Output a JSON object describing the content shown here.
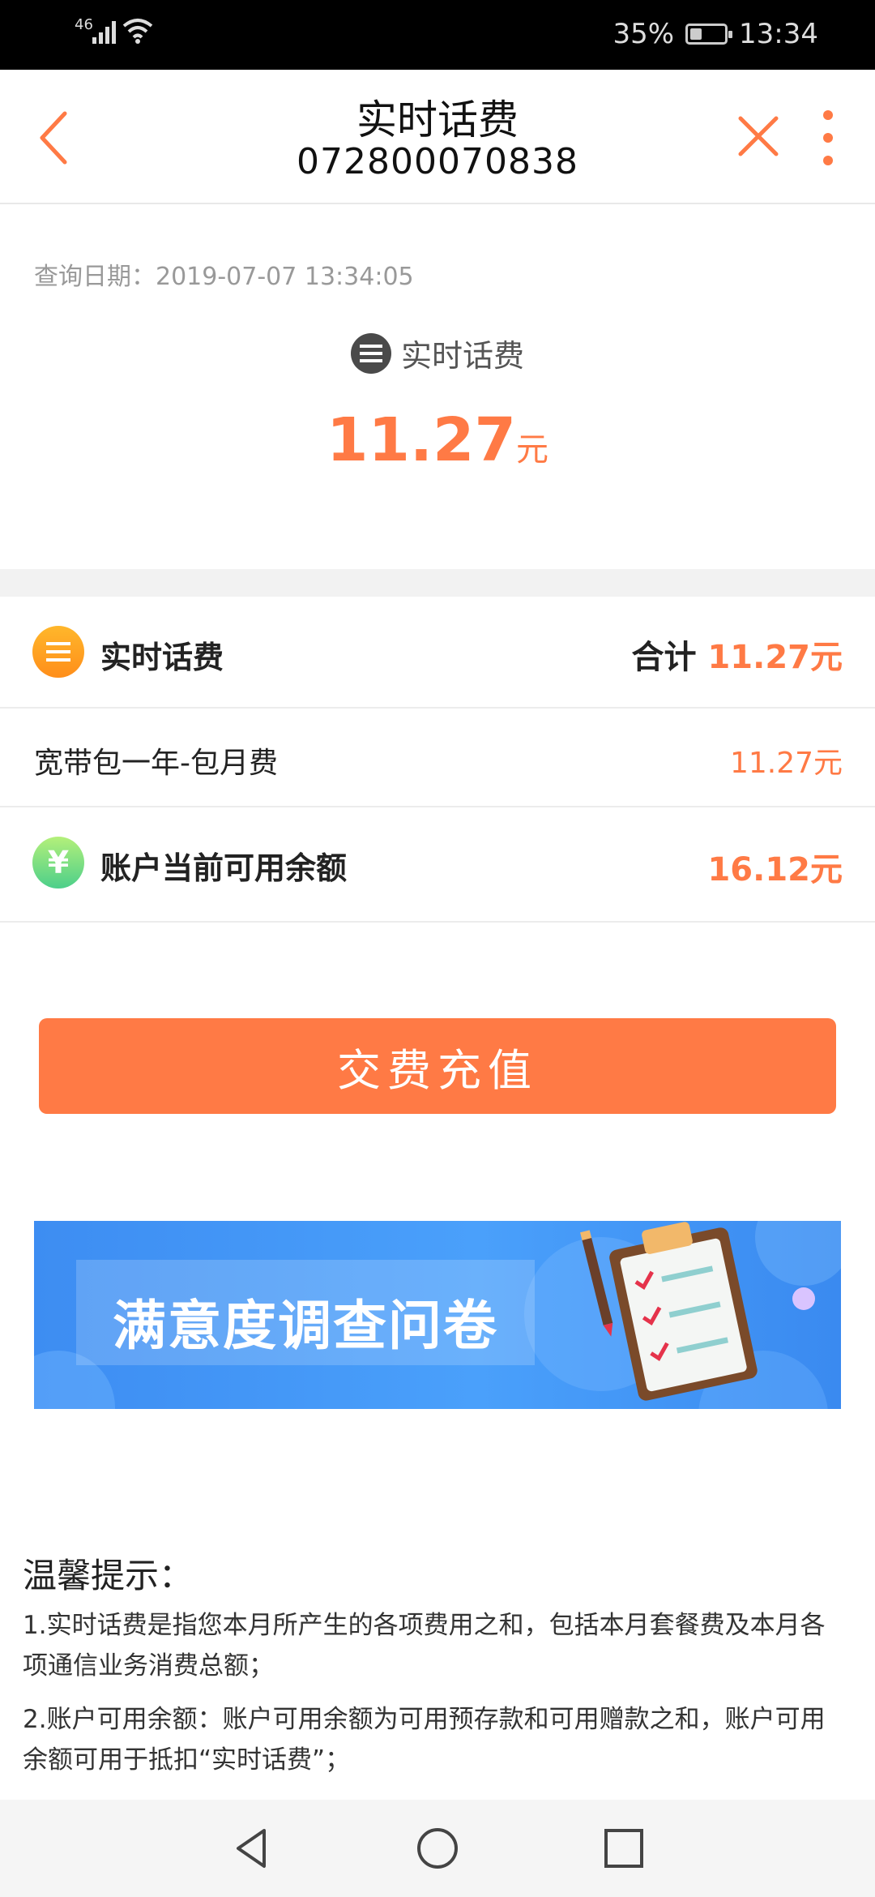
{
  "status_bar": {
    "network": "46",
    "battery_percent": "35%",
    "battery_level": 0.35,
    "time": "13:34"
  },
  "header": {
    "title": "实时话费",
    "phone_number": "072800070838",
    "icons": [
      "back-icon",
      "close-icon",
      "more-icon"
    ]
  },
  "summary": {
    "query_date_label": "查询日期：",
    "query_date_value": "2019-07-07 13:34:05",
    "label": "实时话费",
    "amount": "11.27",
    "unit": "元"
  },
  "bill_rows": {
    "realtime": {
      "label": "实时话费",
      "total_label": "合计",
      "total_value": "11.27元"
    },
    "broadband": {
      "label": "宽带包一年-包月费",
      "value": "11.27元"
    },
    "balance": {
      "label": "账户当前可用余额",
      "value": "16.12元"
    }
  },
  "pay_button": {
    "label": "交费充值"
  },
  "banner": {
    "title": "满意度调查问卷"
  },
  "tips": {
    "title": "温馨提示：",
    "items": [
      "1.实时话费是指您本月所产生的各项费用之和，包括本月套餐费及本月各项通信业务消费总额；",
      "2.账户可用余额：账户可用余额为可用预存款和可用赠款之和，账户可用余额可用于抵扣“实时话费”；"
    ]
  },
  "colors": {
    "accent": "#ff7a45",
    "header_text": "#111111",
    "muted": "#999999",
    "banner_blue": "#3d8df2"
  }
}
